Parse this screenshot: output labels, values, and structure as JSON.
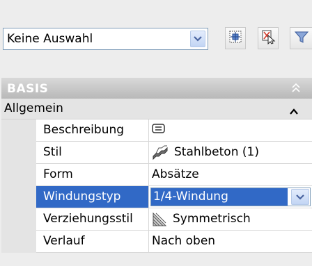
{
  "toolbar": {
    "selection_value": "Keine Auswahl",
    "buttons": [
      {
        "icon": "quick-select-icon"
      },
      {
        "icon": "select-objects-icon"
      },
      {
        "icon": "filter-icon"
      }
    ]
  },
  "palette": {
    "section_title": "BASIS",
    "category_title": "Allgemein",
    "properties": [
      {
        "name": "Beschreibung",
        "value": "",
        "icon": "description-icon"
      },
      {
        "name": "Stil",
        "value": "Stahlbeton (1)",
        "icon": "stair-style-icon"
      },
      {
        "name": "Form",
        "value": "Absätze"
      },
      {
        "name": "Windungstyp",
        "value": "1/4-Windung"
      },
      {
        "name": "Verziehungsstil",
        "value": "Symmetrisch",
        "icon": "winder-style-icon"
      },
      {
        "name": "Verlauf",
        "value": "Nach oben"
      }
    ]
  },
  "colors": {
    "selection": "#3169c6",
    "header_gradient_top": "#d9d9d9",
    "field_border": "#7f9db9"
  }
}
